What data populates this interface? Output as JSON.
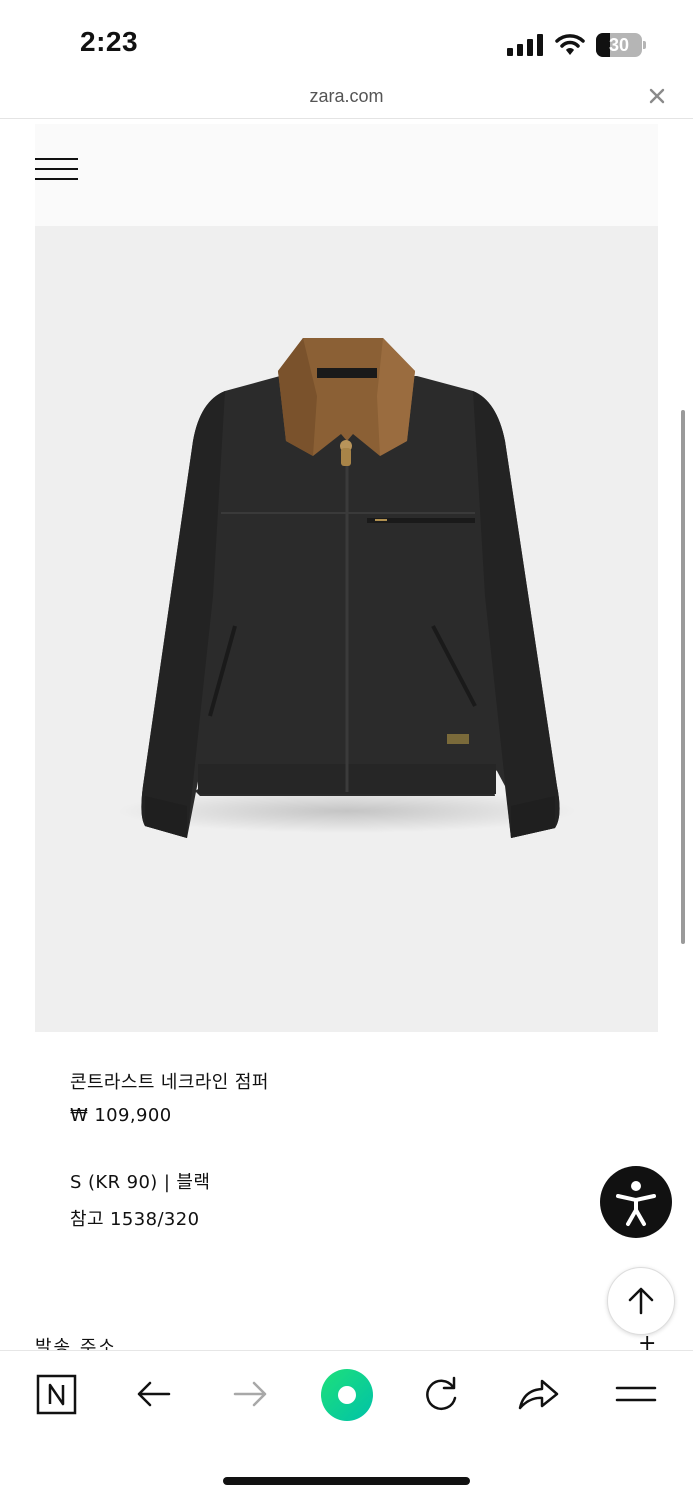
{
  "status_bar": {
    "time": "2:23",
    "battery_level": "30"
  },
  "browser": {
    "url": "zara.com"
  },
  "product": {
    "name": "콘트라스트 네크라인 점퍼",
    "price": "₩ 109,900",
    "variant": "S (KR 90) | 블랙",
    "reference": "참고 1538/320"
  },
  "sections": {
    "shipping_address": "발송 주소",
    "expand_symbol": "+"
  },
  "colors": {
    "toolbar_accent": "#00c73c"
  },
  "toolbar": {
    "items": [
      "naver-logo-icon",
      "back-arrow-icon",
      "forward-arrow-icon",
      "green-dot-icon",
      "reload-icon",
      "share-icon",
      "menu-icon"
    ]
  }
}
